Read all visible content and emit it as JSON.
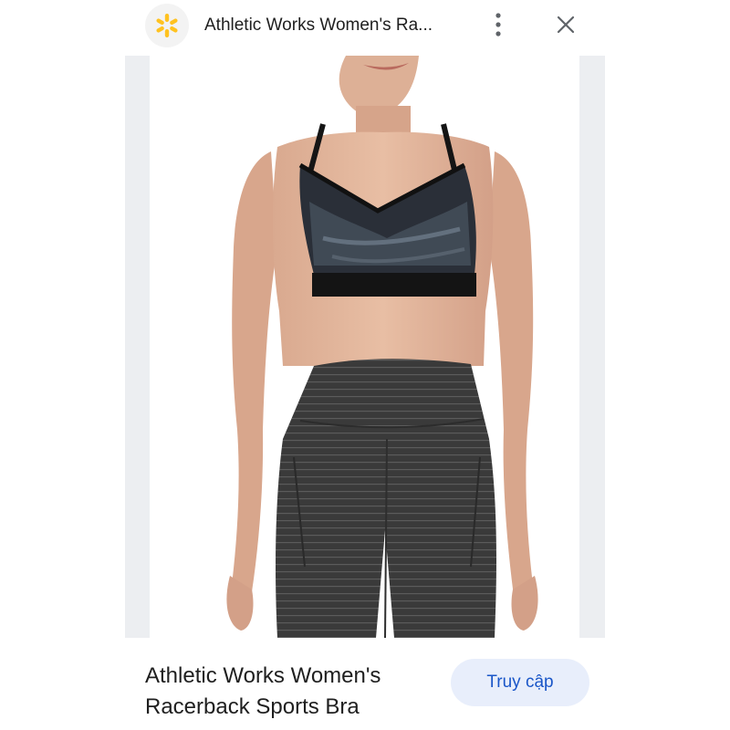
{
  "header": {
    "site_logo_icon": "walmart-spark-icon",
    "title": "Athletic Works Women's Ra...",
    "more_icon": "more-vertical-icon",
    "close_icon": "close-icon"
  },
  "product": {
    "image_description_icon": "product-photo",
    "name": "Athletic Works Women's Racerback Sports Bra",
    "visit_label": "Truy cập"
  },
  "colors": {
    "spark_yellow": "#ffc220",
    "button_bg": "#e8eefb",
    "button_text": "#1a56c8",
    "frame_bg": "#eceef1"
  }
}
